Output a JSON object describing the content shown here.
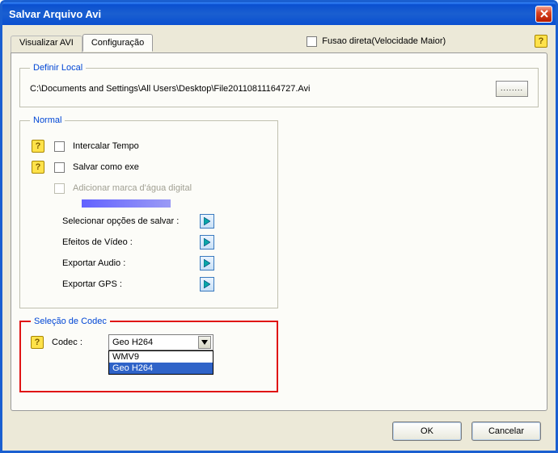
{
  "window": {
    "title": "Salvar Arquivo Avi"
  },
  "toprow": {
    "tab_preview": "Visualizar AVI",
    "tab_config": "Configuração",
    "fusao_label": "Fusao direta(Velocidade Maior)"
  },
  "location": {
    "legend": "Definir Local",
    "path": "C:\\Documents and Settings\\All Users\\Desktop\\File20110811164727.Avi",
    "browse_label": "........"
  },
  "normal": {
    "legend": "Normal",
    "interleave": "Intercalar Tempo",
    "save_exe": "Salvar como exe",
    "watermark": "Adicionar marca d'água digital",
    "save_options": "Selecionar opções de salvar :",
    "video_effects": "Efeitos de Vídeo :",
    "export_audio": "Exportar Audio :",
    "export_gps": "Exportar GPS :"
  },
  "codec": {
    "legend": "Seleção de Codec",
    "label": "Codec :",
    "selected": "Geo H264",
    "options": [
      "WMV9",
      "Geo H264"
    ]
  },
  "buttons": {
    "ok": "OK",
    "cancel": "Cancelar"
  }
}
